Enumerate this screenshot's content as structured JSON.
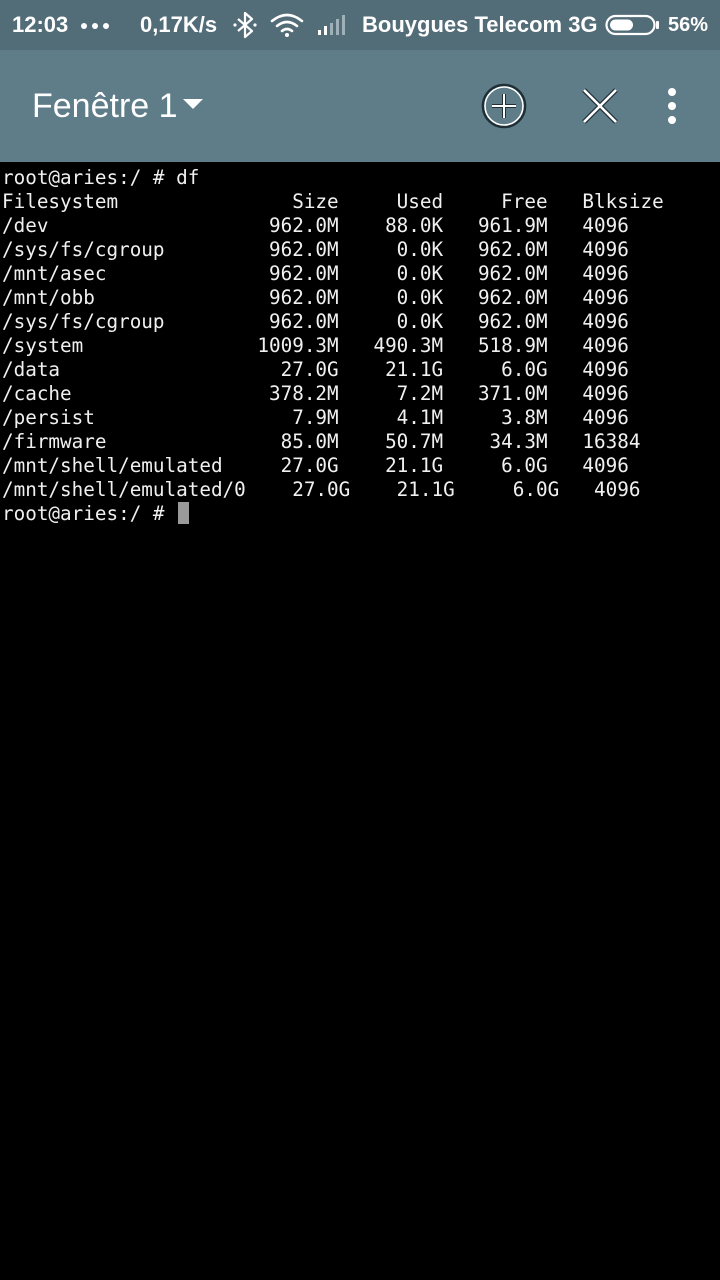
{
  "status_bar": {
    "time": "12:03",
    "speed": "0,17K/s",
    "carrier": "Bouygues Telecom 3G",
    "battery_percent": "56%",
    "battery_level": 0.56,
    "icons": [
      "more-dots-icon",
      "bluetooth-icon",
      "wifi-icon",
      "signal-icon",
      "battery-icon"
    ]
  },
  "toolbar": {
    "title": "Fenêtre 1",
    "actions": [
      "add-window",
      "close-window",
      "overflow-menu"
    ]
  },
  "colors": {
    "status_bar_bg": "#536d78",
    "toolbar_bg": "#5f7d89",
    "terminal_bg": "#000000",
    "terminal_fg": "#f0f0f0",
    "cursor": "#9a9a9a"
  },
  "terminal": {
    "lines": [
      "root@aries:/ # df",
      "Filesystem               Size     Used     Free   Blksize",
      "/dev                   962.0M    88.0K   961.9M   4096",
      "/sys/fs/cgroup         962.0M     0.0K   962.0M   4096",
      "/mnt/asec              962.0M     0.0K   962.0M   4096",
      "/mnt/obb               962.0M     0.0K   962.0M   4096",
      "/sys/fs/cgroup         962.0M     0.0K   962.0M   4096",
      "/system               1009.3M   490.3M   518.9M   4096",
      "/data                   27.0G    21.1G     6.0G   4096",
      "/cache                 378.2M     7.2M   371.0M   4096",
      "/persist                 7.9M     4.1M     3.8M   4096",
      "/firmware               85.0M    50.7M    34.3M   16384",
      "/mnt/shell/emulated     27.0G    21.1G     6.0G   4096",
      "/mnt/shell/emulated/0    27.0G    21.1G     6.0G   4096"
    ],
    "prompt": "root@aries:/ # "
  }
}
